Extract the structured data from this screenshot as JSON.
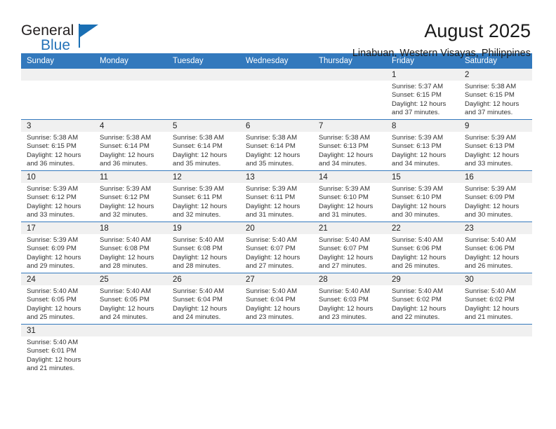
{
  "brand": {
    "name_part1": "General",
    "name_part2": "Blue",
    "flag_icon": "flag-triangle-icon",
    "accent_color": "#1a6fb4"
  },
  "header": {
    "title": "August 2025",
    "subtitle": "Linabuan, Western Visayas, Philippines"
  },
  "theme": {
    "header_bar_color": "#3379bd",
    "daynum_band_color": "#f0f0f0",
    "row_divider_color": "#3379bd",
    "cell_background": "#ffffff"
  },
  "calendar": {
    "weekday_headers": [
      "Sunday",
      "Monday",
      "Tuesday",
      "Wednesday",
      "Thursday",
      "Friday",
      "Saturday"
    ],
    "weeks": [
      [
        {
          "blank": true
        },
        {
          "blank": true
        },
        {
          "blank": true
        },
        {
          "blank": true
        },
        {
          "blank": true
        },
        {
          "day": "1",
          "sunrise": "Sunrise: 5:37 AM",
          "sunset": "Sunset: 6:15 PM",
          "daylight1": "Daylight: 12 hours",
          "daylight2": "and 37 minutes."
        },
        {
          "day": "2",
          "sunrise": "Sunrise: 5:38 AM",
          "sunset": "Sunset: 6:15 PM",
          "daylight1": "Daylight: 12 hours",
          "daylight2": "and 37 minutes."
        }
      ],
      [
        {
          "day": "3",
          "sunrise": "Sunrise: 5:38 AM",
          "sunset": "Sunset: 6:15 PM",
          "daylight1": "Daylight: 12 hours",
          "daylight2": "and 36 minutes."
        },
        {
          "day": "4",
          "sunrise": "Sunrise: 5:38 AM",
          "sunset": "Sunset: 6:14 PM",
          "daylight1": "Daylight: 12 hours",
          "daylight2": "and 36 minutes."
        },
        {
          "day": "5",
          "sunrise": "Sunrise: 5:38 AM",
          "sunset": "Sunset: 6:14 PM",
          "daylight1": "Daylight: 12 hours",
          "daylight2": "and 35 minutes."
        },
        {
          "day": "6",
          "sunrise": "Sunrise: 5:38 AM",
          "sunset": "Sunset: 6:14 PM",
          "daylight1": "Daylight: 12 hours",
          "daylight2": "and 35 minutes."
        },
        {
          "day": "7",
          "sunrise": "Sunrise: 5:38 AM",
          "sunset": "Sunset: 6:13 PM",
          "daylight1": "Daylight: 12 hours",
          "daylight2": "and 34 minutes."
        },
        {
          "day": "8",
          "sunrise": "Sunrise: 5:39 AM",
          "sunset": "Sunset: 6:13 PM",
          "daylight1": "Daylight: 12 hours",
          "daylight2": "and 34 minutes."
        },
        {
          "day": "9",
          "sunrise": "Sunrise: 5:39 AM",
          "sunset": "Sunset: 6:13 PM",
          "daylight1": "Daylight: 12 hours",
          "daylight2": "and 33 minutes."
        }
      ],
      [
        {
          "day": "10",
          "sunrise": "Sunrise: 5:39 AM",
          "sunset": "Sunset: 6:12 PM",
          "daylight1": "Daylight: 12 hours",
          "daylight2": "and 33 minutes."
        },
        {
          "day": "11",
          "sunrise": "Sunrise: 5:39 AM",
          "sunset": "Sunset: 6:12 PM",
          "daylight1": "Daylight: 12 hours",
          "daylight2": "and 32 minutes."
        },
        {
          "day": "12",
          "sunrise": "Sunrise: 5:39 AM",
          "sunset": "Sunset: 6:11 PM",
          "daylight1": "Daylight: 12 hours",
          "daylight2": "and 32 minutes."
        },
        {
          "day": "13",
          "sunrise": "Sunrise: 5:39 AM",
          "sunset": "Sunset: 6:11 PM",
          "daylight1": "Daylight: 12 hours",
          "daylight2": "and 31 minutes."
        },
        {
          "day": "14",
          "sunrise": "Sunrise: 5:39 AM",
          "sunset": "Sunset: 6:10 PM",
          "daylight1": "Daylight: 12 hours",
          "daylight2": "and 31 minutes."
        },
        {
          "day": "15",
          "sunrise": "Sunrise: 5:39 AM",
          "sunset": "Sunset: 6:10 PM",
          "daylight1": "Daylight: 12 hours",
          "daylight2": "and 30 minutes."
        },
        {
          "day": "16",
          "sunrise": "Sunrise: 5:39 AM",
          "sunset": "Sunset: 6:09 PM",
          "daylight1": "Daylight: 12 hours",
          "daylight2": "and 30 minutes."
        }
      ],
      [
        {
          "day": "17",
          "sunrise": "Sunrise: 5:39 AM",
          "sunset": "Sunset: 6:09 PM",
          "daylight1": "Daylight: 12 hours",
          "daylight2": "and 29 minutes."
        },
        {
          "day": "18",
          "sunrise": "Sunrise: 5:40 AM",
          "sunset": "Sunset: 6:08 PM",
          "daylight1": "Daylight: 12 hours",
          "daylight2": "and 28 minutes."
        },
        {
          "day": "19",
          "sunrise": "Sunrise: 5:40 AM",
          "sunset": "Sunset: 6:08 PM",
          "daylight1": "Daylight: 12 hours",
          "daylight2": "and 28 minutes."
        },
        {
          "day": "20",
          "sunrise": "Sunrise: 5:40 AM",
          "sunset": "Sunset: 6:07 PM",
          "daylight1": "Daylight: 12 hours",
          "daylight2": "and 27 minutes."
        },
        {
          "day": "21",
          "sunrise": "Sunrise: 5:40 AM",
          "sunset": "Sunset: 6:07 PM",
          "daylight1": "Daylight: 12 hours",
          "daylight2": "and 27 minutes."
        },
        {
          "day": "22",
          "sunrise": "Sunrise: 5:40 AM",
          "sunset": "Sunset: 6:06 PM",
          "daylight1": "Daylight: 12 hours",
          "daylight2": "and 26 minutes."
        },
        {
          "day": "23",
          "sunrise": "Sunrise: 5:40 AM",
          "sunset": "Sunset: 6:06 PM",
          "daylight1": "Daylight: 12 hours",
          "daylight2": "and 26 minutes."
        }
      ],
      [
        {
          "day": "24",
          "sunrise": "Sunrise: 5:40 AM",
          "sunset": "Sunset: 6:05 PM",
          "daylight1": "Daylight: 12 hours",
          "daylight2": "and 25 minutes."
        },
        {
          "day": "25",
          "sunrise": "Sunrise: 5:40 AM",
          "sunset": "Sunset: 6:05 PM",
          "daylight1": "Daylight: 12 hours",
          "daylight2": "and 24 minutes."
        },
        {
          "day": "26",
          "sunrise": "Sunrise: 5:40 AM",
          "sunset": "Sunset: 6:04 PM",
          "daylight1": "Daylight: 12 hours",
          "daylight2": "and 24 minutes."
        },
        {
          "day": "27",
          "sunrise": "Sunrise: 5:40 AM",
          "sunset": "Sunset: 6:04 PM",
          "daylight1": "Daylight: 12 hours",
          "daylight2": "and 23 minutes."
        },
        {
          "day": "28",
          "sunrise": "Sunrise: 5:40 AM",
          "sunset": "Sunset: 6:03 PM",
          "daylight1": "Daylight: 12 hours",
          "daylight2": "and 23 minutes."
        },
        {
          "day": "29",
          "sunrise": "Sunrise: 5:40 AM",
          "sunset": "Sunset: 6:02 PM",
          "daylight1": "Daylight: 12 hours",
          "daylight2": "and 22 minutes."
        },
        {
          "day": "30",
          "sunrise": "Sunrise: 5:40 AM",
          "sunset": "Sunset: 6:02 PM",
          "daylight1": "Daylight: 12 hours",
          "daylight2": "and 21 minutes."
        }
      ],
      [
        {
          "day": "31",
          "sunrise": "Sunrise: 5:40 AM",
          "sunset": "Sunset: 6:01 PM",
          "daylight1": "Daylight: 12 hours",
          "daylight2": "and 21 minutes."
        },
        {
          "blank": true
        },
        {
          "blank": true
        },
        {
          "blank": true
        },
        {
          "blank": true
        },
        {
          "blank": true
        },
        {
          "blank": true
        }
      ]
    ]
  }
}
